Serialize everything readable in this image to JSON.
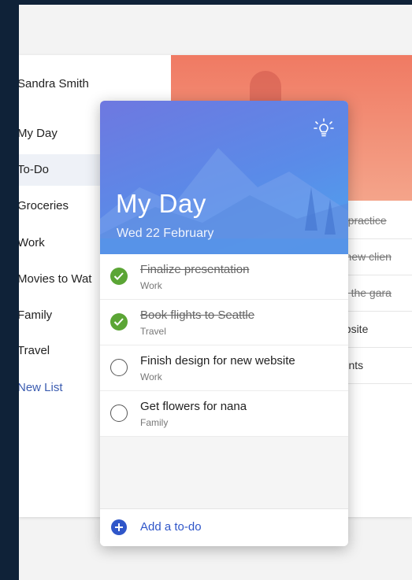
{
  "sidebar": {
    "user_name": "Sandra Smith",
    "items": [
      {
        "label": "My Day"
      },
      {
        "label": "To-Do"
      },
      {
        "label": "Groceries"
      },
      {
        "label": "Work"
      },
      {
        "label": "Movies to Wat"
      },
      {
        "label": "Family"
      },
      {
        "label": "Travel"
      }
    ],
    "new_list_label": "New List"
  },
  "background_list": {
    "rows": [
      {
        "text": "o practice",
        "done": true
      },
      {
        "text": "r new clien",
        "done": true
      },
      {
        "text": "at the gara",
        "done": true
      },
      {
        "text": "ebsite",
        "done": false
      },
      {
        "text": "rents",
        "done": false
      }
    ]
  },
  "card": {
    "title": "My Day",
    "date": "Wed 22 February",
    "icon": "lightbulb-icon",
    "tasks": [
      {
        "title": "Finalize presentation",
        "list": "Work",
        "done": true
      },
      {
        "title": "Book flights to Seattle",
        "list": "Travel",
        "done": true
      },
      {
        "title": "Finish design for new website",
        "list": "Work",
        "done": false
      },
      {
        "title": "Get flowers for nana",
        "list": "Family",
        "done": false
      }
    ],
    "add_label": "Add a to-do"
  },
  "colors": {
    "accent": "#2f56c9",
    "done_green": "#5ba535",
    "outer_bg": "#0f2238"
  }
}
